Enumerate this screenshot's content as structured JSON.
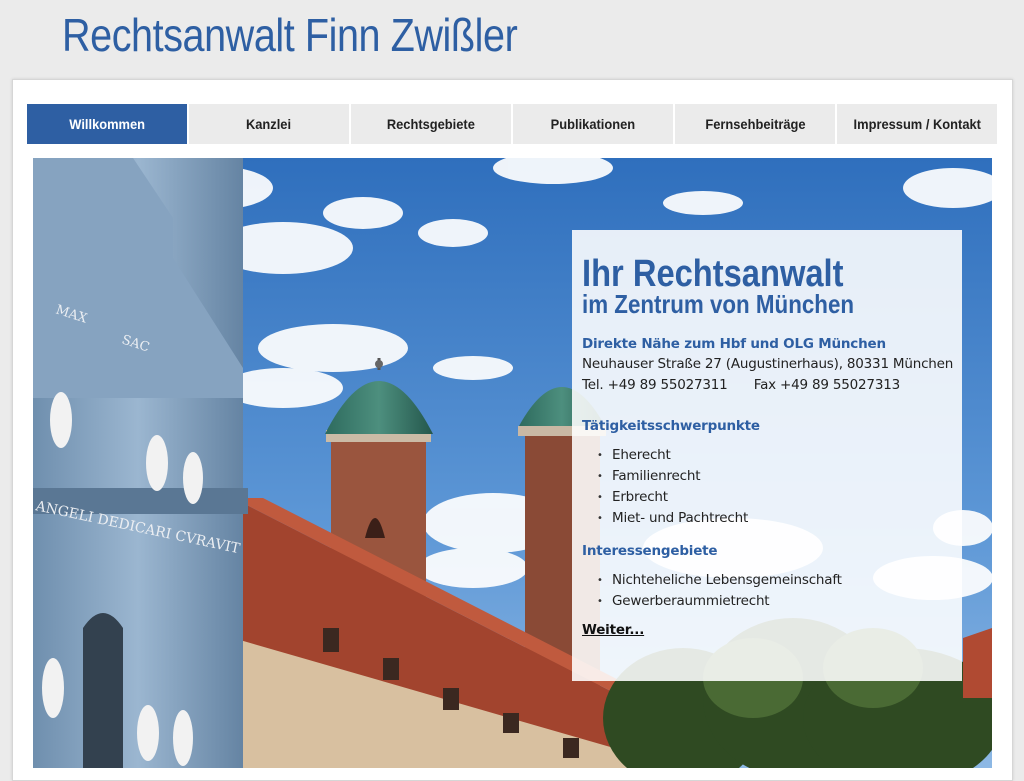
{
  "header": {
    "title": "Rechtsanwalt Finn Zwißler"
  },
  "nav": {
    "items": [
      {
        "label": "Willkommen",
        "active": true
      },
      {
        "label": "Kanzlei"
      },
      {
        "label": "Rechtsgebiete"
      },
      {
        "label": "Publikationen"
      },
      {
        "label": "Fernsehbeiträge"
      },
      {
        "label": "Impressum / Kontakt"
      }
    ]
  },
  "panel": {
    "heading": "Ihr Rechtsanwalt",
    "subheading": "im Zentrum von München",
    "location_note": "Direkte Nähe zum Hbf und OLG München",
    "address": "Neuhauser Straße 27 (Augustinerhaus), 80331 München",
    "phone": "Tel. +49 89 55027311",
    "fax": "Fax +49 89 55027313",
    "focus_title": "Tätigkeitsschwerpunkte",
    "focus_items": [
      "Eherecht",
      "Familienrecht",
      "Erbrecht",
      "Miet- und Pachtrecht"
    ],
    "interest_title": "Interessengebiete",
    "interest_items": [
      "Nichteheliche Lebensgemeinschaft",
      "Gewerberaummietrecht"
    ],
    "more_link": "Weiter..."
  },
  "hero": {
    "image": "munich-frauenkirche-photo",
    "inscription_1": "MAX",
    "inscription_2": "SAC",
    "inscription_3": "ANGELI DEDICARI CVRAVIT"
  },
  "colors": {
    "brand": "#2e5fa3",
    "nav_inactive": "#ebebeb",
    "background": "#ebebeb"
  }
}
